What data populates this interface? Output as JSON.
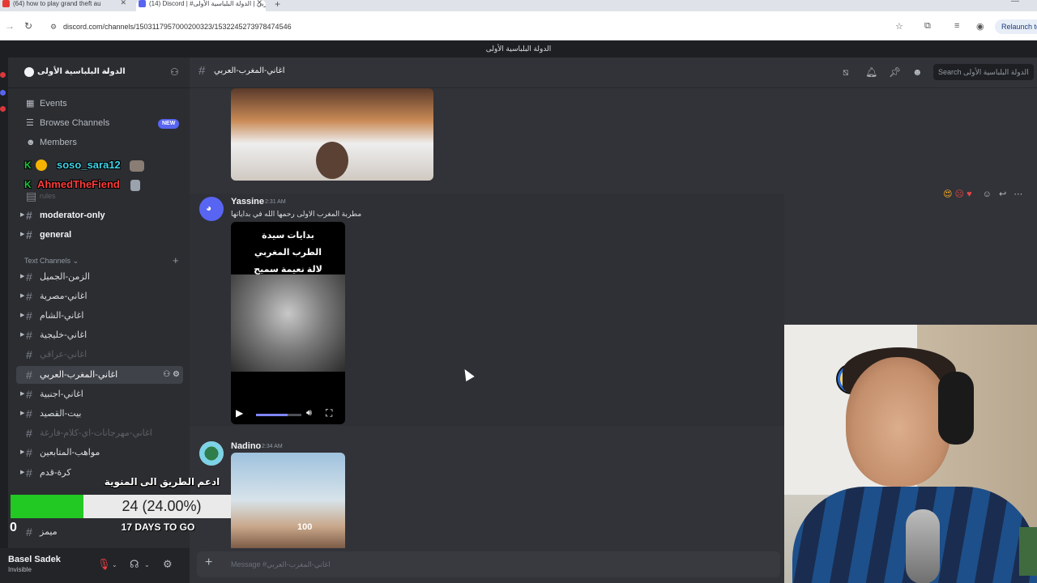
{
  "browser": {
    "tabs": [
      {
        "title": "(64) how to play grand theft au"
      },
      {
        "title": "(14) Discord | #اغاني-المغرب-العربي | الدولة البلباسية الأولى"
      }
    ],
    "url": "discord.com/channels/1503117957000200323/1532245273978474546",
    "relaunch_label": "Relaunch to"
  },
  "window_title": "الدولة البلباسية الأولى",
  "server": {
    "name": "الدولة البلباسية الأولى"
  },
  "sidebar": {
    "top_items": [
      {
        "label": "Events",
        "icon": "calendar-icon"
      },
      {
        "label": "Browse Channels",
        "icon": "channels-icon",
        "badge": "NEW"
      },
      {
        "label": "Members",
        "icon": "members-icon"
      }
    ],
    "overlay_users": [
      {
        "name": "soso_sara12",
        "color": "#3fd3e8"
      },
      {
        "name": "AhmedTheFiend",
        "color": "#ff3b3b"
      }
    ],
    "pinned_channels": [
      {
        "name": "rules",
        "state": "muted"
      },
      {
        "name": "moderator-only",
        "state": "bold"
      },
      {
        "name": "general",
        "state": "bold"
      }
    ],
    "category_label": "Text Channels",
    "channels": [
      {
        "name": "الزمن-الجميل",
        "state": "normal"
      },
      {
        "name": "اغاني-مصرية",
        "state": "normal"
      },
      {
        "name": "اغاني-الشام",
        "state": "normal"
      },
      {
        "name": "اغاني-خليجية",
        "state": "normal"
      },
      {
        "name": "اغاني-عراقي",
        "state": "muted"
      },
      {
        "name": "اغاني-المغرب-العربي",
        "state": "active"
      },
      {
        "name": "اغاني-اجنبية",
        "state": "normal"
      },
      {
        "name": "بيت-القصيد",
        "state": "normal"
      },
      {
        "name": "اغاني-مهرجانات-اي-كلام-فارغة",
        "state": "muted"
      },
      {
        "name": "مواهب-المتابعين",
        "state": "normal"
      },
      {
        "name": "كرة-قدم",
        "state": "normal"
      },
      {
        "name": "ميمز",
        "state": "normal"
      }
    ]
  },
  "donation": {
    "title": "ادعم الطريق الى المنوية",
    "progress_label": "24 (24.00%)",
    "progress_fraction": 0.24,
    "days_label": "17 DAYS TO GO",
    "zero_label": "0"
  },
  "user_panel": {
    "name": "Basel Sadek",
    "status": "Invisible"
  },
  "chat": {
    "channel_name": "اغاني-المغرب-العربي",
    "search_placeholder": "Search الدولة البلباسية الأولى",
    "messages": [
      {
        "author": "Yassine",
        "time": "2:31 AM",
        "text": "مطربة المغرب الاولى رحمها الله في بداياتها",
        "video_caption": [
          "بدايات سيدة",
          "الطرب المغربي",
          "لالة نعيمة سميح"
        ]
      },
      {
        "author": "Nadino",
        "time": "2:34 AM",
        "image_label": "100"
      }
    ],
    "video_progress": 0.7,
    "composer_placeholder": "Message #اغاني-المغرب-العربي"
  },
  "colors": {
    "accent": "#5865f2",
    "donation_fill": "#22c923",
    "background": "#313338"
  }
}
